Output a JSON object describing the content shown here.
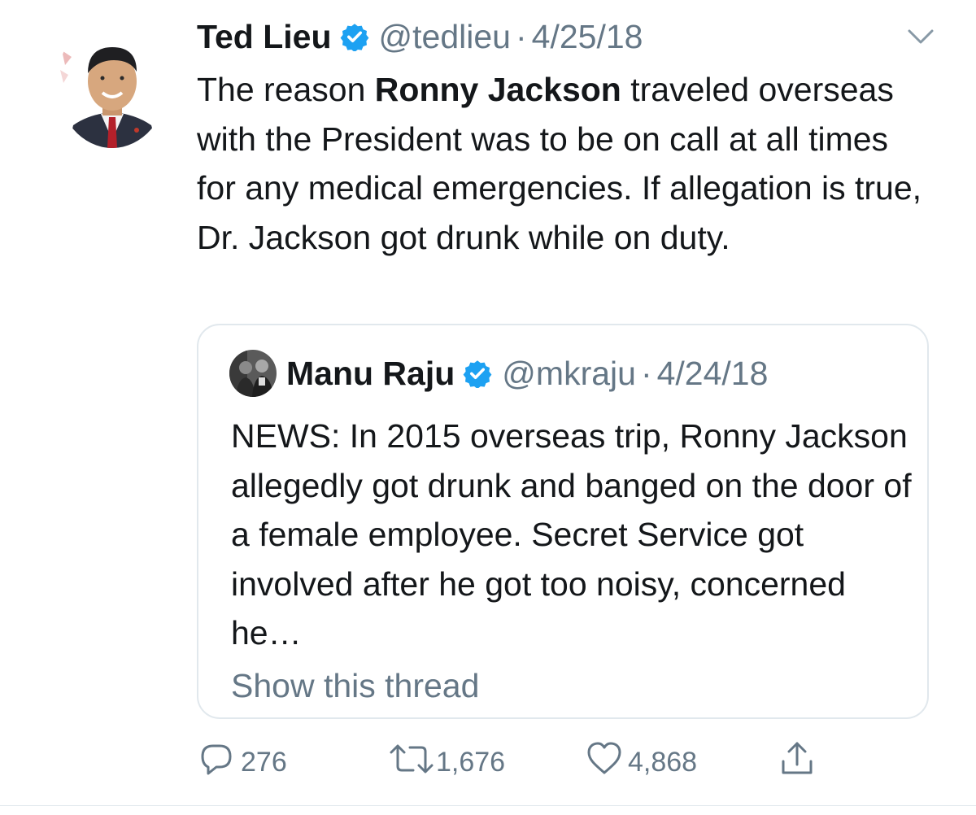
{
  "tweet": {
    "author_name": "Ted Lieu",
    "handle": "@tedlieu",
    "separator": "·",
    "date": "4/25/18",
    "text_before": "The reason ",
    "text_bold": "Ronny Jackson",
    "text_after": " traveled overseas with the President was to be on call at all times for any medical emergencies. If allegation is true, Dr. Jackson got drunk while on duty."
  },
  "quoted_tweet": {
    "author_name": "Manu Raju",
    "handle": "@mkraju",
    "separator": "·",
    "date": "4/24/18",
    "text": "NEWS: In 2015 overseas trip, Ronny Jackson allegedly got drunk and banged on the door of a female employee. Secret Service got involved after he got too noisy, concerned he…",
    "show_thread_label": "Show this thread"
  },
  "actions": {
    "reply_count": "276",
    "retweet_count": "1,676",
    "like_count": "4,868"
  },
  "icons": {
    "verified": "verified-badge-icon",
    "caret": "chevron-down-icon",
    "reply": "reply-icon",
    "retweet": "retweet-icon",
    "like": "heart-icon",
    "share": "share-icon"
  },
  "colors": {
    "text": "#14171a",
    "secondary": "#657786",
    "verified": "#1da1f2",
    "border": "#e1e8ed"
  }
}
